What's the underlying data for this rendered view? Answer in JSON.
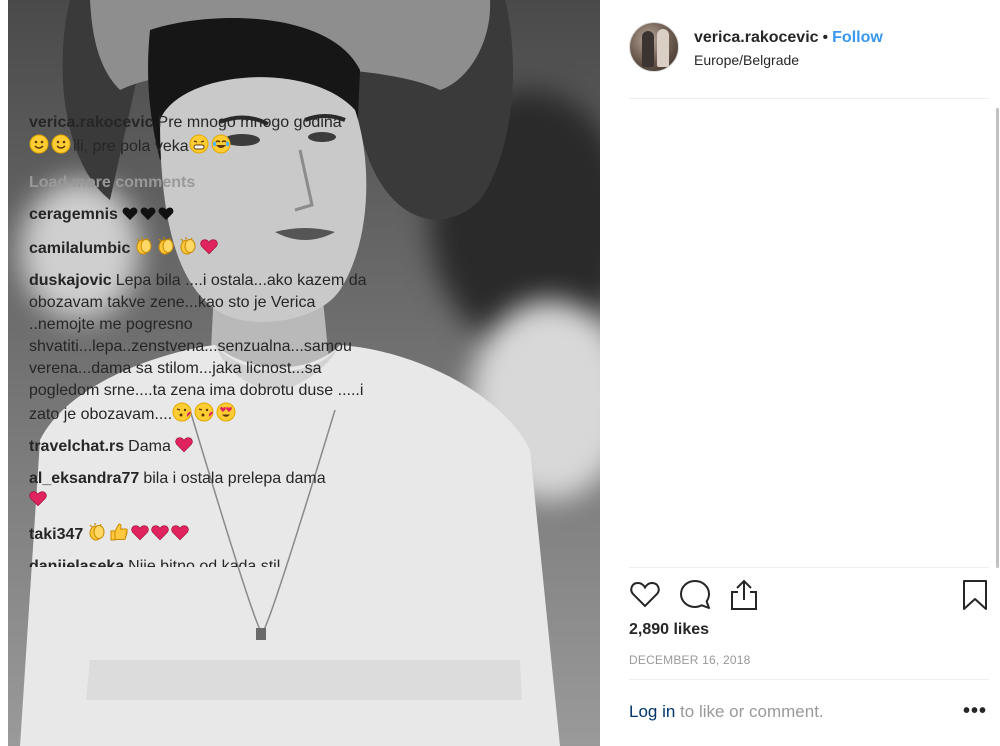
{
  "post": {
    "username": "verica.rakocevic",
    "separator": "•",
    "follow_label": "Follow",
    "location": "Europe/Belgrade",
    "load_more_label": "Load more comments",
    "likes": "2,890 likes",
    "date": "DECEMBER 16, 2018",
    "login_link": "Log in",
    "login_rest": " to like or comment.",
    "more_label": "•••"
  },
  "caption": {
    "username": "verica.rakocevic",
    "text_1": "Pre mnogo mnogo godina",
    "text_2": "ili, pre pola veka"
  },
  "comments": [
    {
      "username": "ceragemnis",
      "text": ""
    },
    {
      "username": "camilalumbic",
      "text": ""
    },
    {
      "username": "duskajovic",
      "text": "Lepa bila ....i ostala...ako kazem da obozavam takve zene...kao sto je Verica ..nemojte me pogresno shvatiti...lepa..zenstvena...senzualna...samou verena...dama sa stilom...jaka licnost...sa pogledom srne....ta zena ima dobrotu duse .....i zato je obozavam...."
    },
    {
      "username": "travelchat.rs",
      "text": "Dama"
    },
    {
      "username": "al_eksandra77",
      "text": "bila i ostala prelepa dama"
    },
    {
      "username": "taki347",
      "text": ""
    },
    {
      "username": "danijelaseka",
      "text": "Nije bitno od kada,stil ostaje...pozzz"
    }
  ],
  "icons": {
    "like": "heart-icon",
    "comment": "comment-icon",
    "share": "share-icon",
    "save": "bookmark-icon",
    "emoji": [
      "smiley-icon",
      "grinning-icon",
      "joy-icon",
      "black-heart-icon",
      "clapping-hands-icon",
      "red-heart-icon",
      "kissing-heart-icon",
      "heart-eyes-icon",
      "thumbs-up-icon"
    ]
  },
  "colors": {
    "link_blue": "#3897f0",
    "login_blue": "#003569",
    "muted": "#999999",
    "text": "#262626",
    "heart_red": "#e0245e"
  }
}
